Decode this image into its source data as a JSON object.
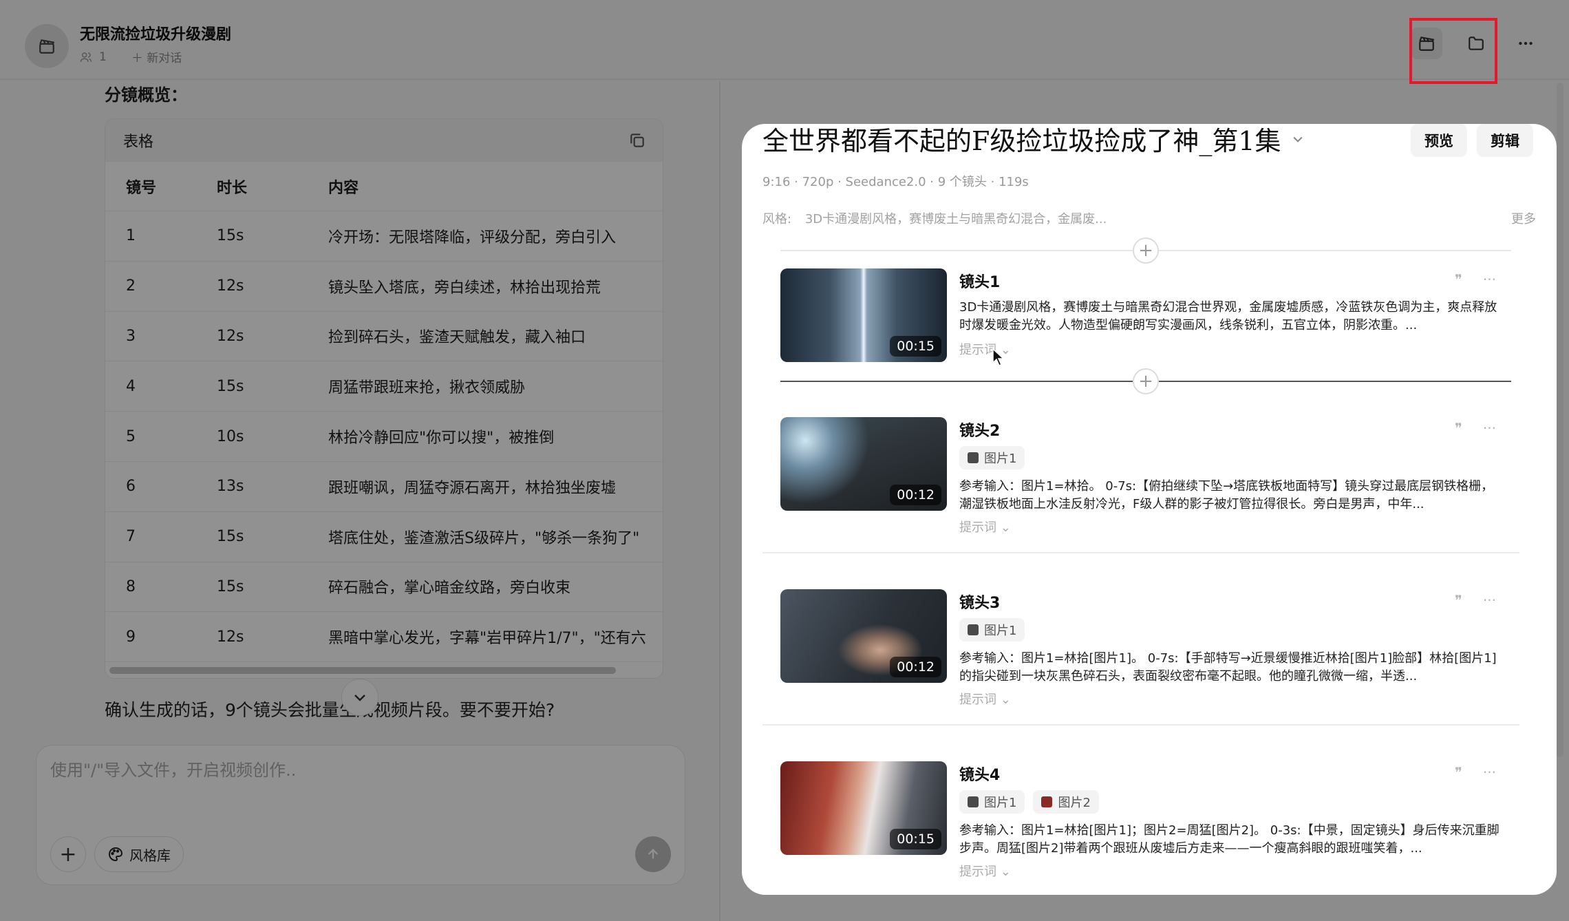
{
  "header": {
    "project_title": "无限流捡垃圾升级漫剧",
    "member_count": "1",
    "new_chat_label": "新对话",
    "icons": [
      "clapperboard-icon",
      "folder-icon",
      "more-icon"
    ]
  },
  "chat": {
    "section_title": "分镜概览：",
    "table": {
      "label": "表格",
      "columns": [
        "镜号",
        "时长",
        "内容"
      ],
      "rows": [
        {
          "no": "1",
          "duration": "15s",
          "content": "冷开场：无限塔降临，评级分配，旁白引入"
        },
        {
          "no": "2",
          "duration": "12s",
          "content": "镜头坠入塔底，旁白续述，林拾出现拾荒"
        },
        {
          "no": "3",
          "duration": "12s",
          "content": "捡到碎石头，鉴渣天赋触发，藏入袖口"
        },
        {
          "no": "4",
          "duration": "15s",
          "content": "周猛带跟班来抢，揪衣领威胁"
        },
        {
          "no": "5",
          "duration": "10s",
          "content": "林拾冷静回应\"你可以搜\"，被推倒"
        },
        {
          "no": "6",
          "duration": "13s",
          "content": "跟班嘲讽，周猛夺源石离开，林拾独坐废墟"
        },
        {
          "no": "7",
          "duration": "15s",
          "content": "塔底住处，鉴渣激活S级碎片，\"够杀一条狗了\""
        },
        {
          "no": "8",
          "duration": "15s",
          "content": "碎石融合，掌心暗金纹路，旁白收束"
        },
        {
          "no": "9",
          "duration": "12s",
          "content": "黑暗中掌心发光，字幕\"岩甲碎片1/7\"，\"还有六"
        }
      ]
    },
    "confirm_text": "确认生成的话，9个镜头会批量生成视频片段。要不要开始?",
    "composer": {
      "placeholder": "使用\"/\"导入文件，开启视频创作..",
      "style_library_label": "风格库"
    }
  },
  "storyboard": {
    "title": "全世界都看不起的F级捡垃圾捡成了神_第1集",
    "preview_label": "预览",
    "edit_label": "剪辑",
    "meta": "9:16 · 720p · Seedance2.0 · 9 个镜头 · 119s",
    "style_label": "风格:",
    "style_value": "3D卡通漫剧风格，赛博废土与暗黑奇幻混合，金属废...",
    "more_label": "更多",
    "prompt_label": "提示词",
    "shots": [
      {
        "title": "镜头1",
        "duration": "00:15",
        "chips": [],
        "description": "3D卡通漫剧风格，赛博废土与暗黑奇幻混合世界观，金属废墟质感，冷蓝铁灰色调为主，爽点释放时爆发暖金光效。人物造型偏硬朗写实漫画风，线条锐利，五官立体，阴影浓重。..."
      },
      {
        "title": "镜头2",
        "duration": "00:12",
        "chips": [
          "图片1"
        ],
        "description": "参考输入：图片1=林拾。 0-7s:【俯拍继续下坠→塔底铁板地面特写】镜头穿过最底层钢铁格栅，潮湿铁板地面上水洼反射冷光，F级人群的影子被灯管拉得很长。旁白是男声，中年..."
      },
      {
        "title": "镜头3",
        "duration": "00:12",
        "chips": [
          "图片1"
        ],
        "description": "参考输入：图片1=林拾[图片1]。 0-7s:【手部特写→近景缓慢推近林拾[图片1]脸部】林拾[图片1]的指尖碰到一块灰黑色碎石头，表面裂纹密布毫不起眼。他的瞳孔微微一缩，半透..."
      },
      {
        "title": "镜头4",
        "duration": "00:15",
        "chips": [
          "图片1",
          "图片2"
        ],
        "description": "参考输入：图片1=林拾[图片1]；图片2=周猛[图片2]。 0-3s:【中景，固定镜头】身后传来沉重脚步声。周猛[图片2]带着两个跟班从废墟后方走来——一个瘦高斜眼的跟班嗤笑着，..."
      }
    ]
  },
  "colors": {
    "highlight": "#e5192a",
    "panel_bg": "#ffffff",
    "overlay": "rgba(0,0,0,0.43)"
  }
}
